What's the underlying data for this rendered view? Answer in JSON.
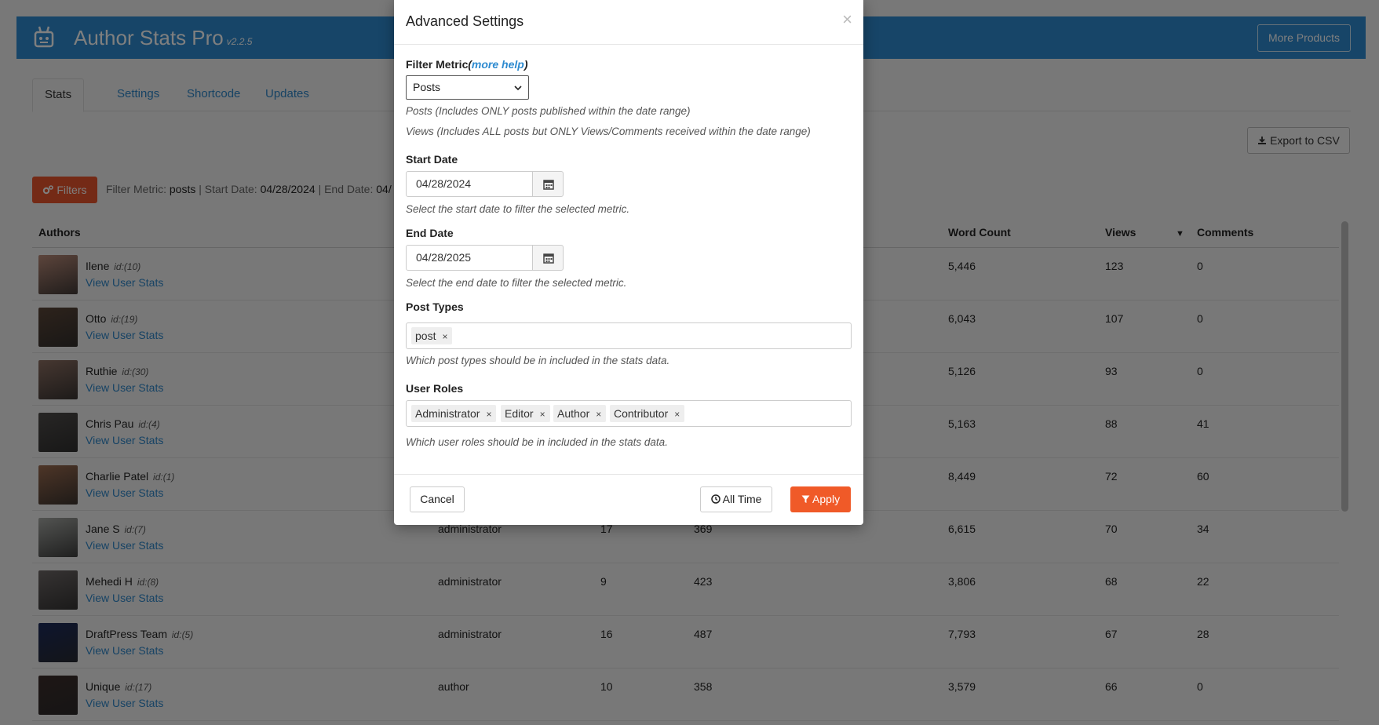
{
  "app": {
    "title": "Author Stats Pro",
    "version": "v2.2.5",
    "more_products_label": "More Products"
  },
  "tabs": [
    {
      "label": "Stats"
    },
    {
      "label": "Settings"
    },
    {
      "label": "Shortcode"
    },
    {
      "label": "Updates"
    }
  ],
  "toolbar": {
    "export_label": "Export to CSV",
    "filters_label": "Filters",
    "summary": {
      "metric_label": "Filter Metric:",
      "metric_value": "posts",
      "start_label": "| Start Date:",
      "start_value": "04/28/2024",
      "end_label": "| End Date:",
      "end_value": "04/"
    }
  },
  "table": {
    "headers": {
      "authors": "Authors",
      "word_count": "Word Count",
      "views": "Views",
      "comments": "Comments"
    },
    "view_link_label": "View User Stats",
    "rows": [
      {
        "name": "Ilene",
        "id": "id:(10)",
        "role": "",
        "posts": "",
        "c3": "",
        "words": "5,446",
        "views": "123",
        "comments": "0",
        "avatar_color": "#b98a78"
      },
      {
        "name": "Otto",
        "id": "id:(19)",
        "role": "",
        "posts": "",
        "c3": "",
        "words": "6,043",
        "views": "107",
        "comments": "0",
        "avatar_color": "#5b4638"
      },
      {
        "name": "Ruthie",
        "id": "id:(30)",
        "role": "",
        "posts": "",
        "c3": "",
        "words": "5,126",
        "views": "93",
        "comments": "0",
        "avatar_color": "#8d6f62"
      },
      {
        "name": "Chris Pau",
        "id": "id:(4)",
        "role": "",
        "posts": "",
        "c3": "",
        "words": "5,163",
        "views": "88",
        "comments": "41",
        "avatar_color": "#4f4c4a"
      },
      {
        "name": "Charlie Patel",
        "id": "id:(1)",
        "role": "",
        "posts": "",
        "c3": "",
        "words": "8,449",
        "views": "72",
        "comments": "60",
        "avatar_color": "#9b6b4f"
      },
      {
        "name": "Jane S",
        "id": "id:(7)",
        "role": "administrator",
        "posts": "17",
        "c3": "369",
        "words": "6,615",
        "views": "70",
        "comments": "34",
        "avatar_color": "#a6a8a4"
      },
      {
        "name": "Mehedi H",
        "id": "id:(8)",
        "role": "administrator",
        "posts": "9",
        "c3": "423",
        "words": "3,806",
        "views": "68",
        "comments": "22",
        "avatar_color": "#6d6766"
      },
      {
        "name": "DraftPress Team",
        "id": "id:(5)",
        "role": "administrator",
        "posts": "16",
        "c3": "487",
        "words": "7,793",
        "views": "67",
        "comments": "28",
        "avatar_color": "#1c2a5c"
      },
      {
        "name": "Unique",
        "id": "id:(17)",
        "role": "author",
        "posts": "10",
        "c3": "358",
        "words": "3,579",
        "views": "66",
        "comments": "0",
        "avatar_color": "#3c2d2a"
      }
    ]
  },
  "modal": {
    "title": "Advanced Settings",
    "close_symbol": "×",
    "filter_metric": {
      "label": "Filter Metric",
      "help_open": "(",
      "help_link": "more help",
      "help_close": ")",
      "selected": "Posts",
      "hint_posts": "Posts (Includes ONLY posts published within the date range)",
      "hint_views": "Views (Includes ALL posts but ONLY Views/Comments received within the date range)"
    },
    "start_date": {
      "label": "Start Date",
      "value": "04/28/2024",
      "hint": "Select the start date to filter the selected metric."
    },
    "end_date": {
      "label": "End Date",
      "value": "04/28/2025",
      "hint": "Select the end date to filter the selected metric."
    },
    "post_types": {
      "label": "Post Types",
      "tags": [
        "post"
      ],
      "hint": "Which post types should be in included in the stats data."
    },
    "user_roles": {
      "label": "User Roles",
      "tags": [
        "Administrator",
        "Editor",
        "Author",
        "Contributor"
      ],
      "hint": "Which user roles should be in included in the stats data."
    },
    "buttons": {
      "cancel": "Cancel",
      "all_time": "All Time",
      "apply": "Apply"
    }
  },
  "colors": {
    "header_blue": "#2e8bd0",
    "link_blue": "#2e86c9",
    "filters_orange": "#e8542c",
    "apply_orange": "#f05a28"
  }
}
